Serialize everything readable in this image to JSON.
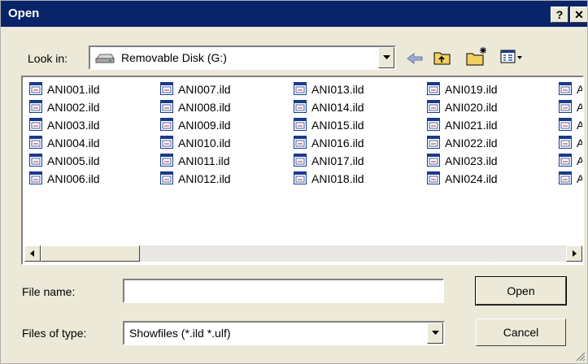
{
  "window": {
    "title": "Open",
    "help_label": "?",
    "close_label": "✕"
  },
  "lookin": {
    "label": "Look in:",
    "value": "Removable Disk (G:)",
    "icon": "drive-icon"
  },
  "toolbar": [
    "back-icon",
    "up-folder-icon",
    "new-folder-icon",
    "view-menu-icon"
  ],
  "files": [
    [
      "ANI001.ild",
      "ANI002.ild",
      "ANI003.ild",
      "ANI004.ild",
      "ANI005.ild",
      "ANI006.ild"
    ],
    [
      "ANI007.ild",
      "ANI008.ild",
      "ANI009.ild",
      "ANI010.ild",
      "ANI011.ild",
      "ANI012.ild"
    ],
    [
      "ANI013.ild",
      "ANI014.ild",
      "ANI015.ild",
      "ANI016.ild",
      "ANI017.ild",
      "ANI018.ild"
    ],
    [
      "ANI019.ild",
      "ANI020.ild",
      "ANI021.ild",
      "ANI022.ild",
      "ANI023.ild",
      "ANI024.ild"
    ],
    [
      "A",
      "A",
      "A",
      "A",
      "A",
      "A"
    ]
  ],
  "filename": {
    "label": "File name:",
    "value": ""
  },
  "filetype": {
    "label": "Files of type:",
    "value": "Showfiles (*.ild *.ulf)"
  },
  "buttons": {
    "open": "Open",
    "cancel": "Cancel"
  }
}
